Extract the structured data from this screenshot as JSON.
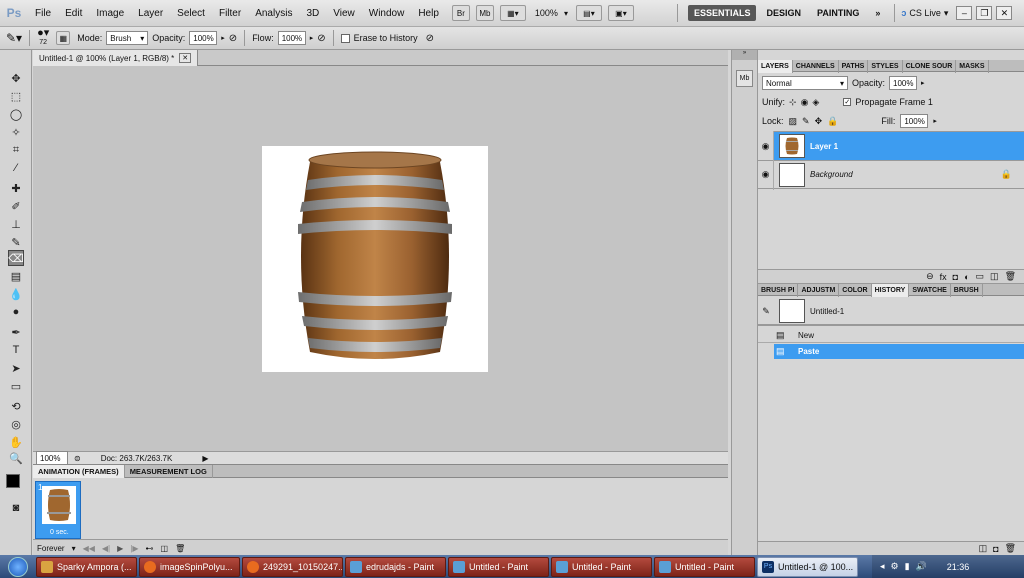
{
  "app": {
    "logo": "Ps"
  },
  "menu": [
    "File",
    "Edit",
    "Image",
    "Layer",
    "Select",
    "Filter",
    "Analysis",
    "3D",
    "View",
    "Window",
    "Help"
  ],
  "appbar": {
    "br": "Br",
    "mb": "Mb",
    "zoom": "100%",
    "ws_essentials": "ESSENTIALS",
    "ws_design": "DESIGN",
    "ws_painting": "PAINTING",
    "ws_more": "»",
    "cslive": "CS Live"
  },
  "options": {
    "brush_size": "72",
    "mode_label": "Mode:",
    "mode_value": "Brush",
    "opacity_label": "Opacity:",
    "opacity_value": "100%",
    "flow_label": "Flow:",
    "flow_value": "100%",
    "erase_history": "Erase to History"
  },
  "document": {
    "tab_title": "Untitled-1 @ 100% (Layer 1, RGB/8) *",
    "zoom": "100%",
    "doc_info": "Doc: 263.7K/263.7K"
  },
  "animation": {
    "tab_frames": "ANIMATION (FRAMES)",
    "tab_measure": "MEASUREMENT LOG",
    "frame_number": "1",
    "frame_delay": "0 sec.",
    "loop": "Forever"
  },
  "layers_panel": {
    "tabs": [
      "LAYERS",
      "CHANNELS",
      "PATHS",
      "STYLES",
      "CLONE SOUR",
      "MASKS"
    ],
    "blend_mode": "Normal",
    "opacity_label": "Opacity:",
    "opacity_value": "100%",
    "unify_label": "Unify:",
    "propagate_label": "Propagate Frame 1",
    "lock_label": "Lock:",
    "fill_label": "Fill:",
    "fill_value": "100%",
    "layers": [
      {
        "name": "Layer 1",
        "selected": true
      },
      {
        "name": "Background",
        "selected": false
      }
    ]
  },
  "history_panel": {
    "tabs": [
      "BRUSH PI",
      "ADJUSTM",
      "COLOR",
      "HISTORY",
      "SWATCHE",
      "BRUSH"
    ],
    "snapshot": "Untitled-1",
    "states": [
      {
        "name": "New",
        "selected": false
      },
      {
        "name": "Paste",
        "selected": true
      }
    ]
  },
  "taskbar": {
    "tasks": [
      {
        "label": "Sparky Ampora (...",
        "active": false
      },
      {
        "label": "imageSpinPolyu...",
        "active": false
      },
      {
        "label": "249291_10150247...",
        "active": false
      },
      {
        "label": "edrudajds - Paint",
        "active": false
      },
      {
        "label": "Untitled - Paint",
        "active": false
      },
      {
        "label": "Untitled - Paint",
        "active": false
      },
      {
        "label": "Untitled - Paint",
        "active": false
      },
      {
        "label": "Untitled-1 @ 100...",
        "active": true
      }
    ],
    "clock": "21:36"
  },
  "colors": {
    "selection": "#3d9cf0",
    "taskbar": "#2c4a78",
    "task_button": "#9a3328"
  }
}
